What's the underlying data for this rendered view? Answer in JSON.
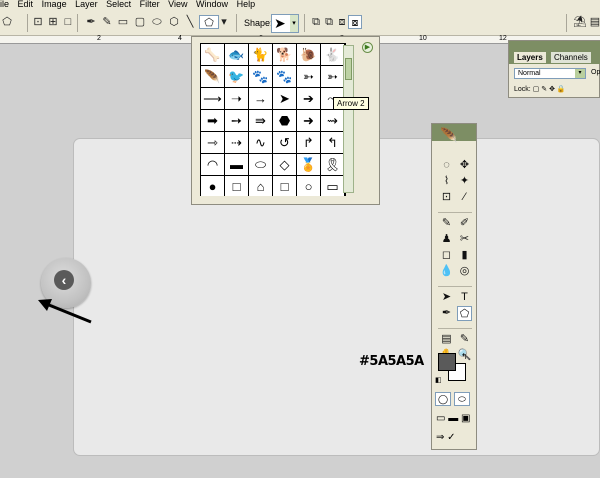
{
  "menu": [
    "ile",
    "Edit",
    "Image",
    "Layer",
    "Select",
    "Filter",
    "View",
    "Window",
    "Help"
  ],
  "options_bar": {
    "shape_label": "Shape:",
    "shape_value": "➤"
  },
  "ruler": {
    "marks": [
      "2",
      "4",
      "6",
      "8",
      "10",
      "12"
    ]
  },
  "shape_picker": {
    "tooltip": "Arrow 2",
    "items": [
      "🦴",
      "🐟",
      "🐈",
      "🐕",
      "🐌",
      "🐇",
      "🪶",
      "🐦",
      "🐾",
      "🐾",
      "➳",
      "➳",
      "⟶",
      "➝",
      "→",
      "➤",
      "➔",
      "⤳",
      "➡",
      "➙",
      "⇛",
      "⬣",
      "➜",
      "⇝",
      "⇾",
      "⇢",
      "∿",
      "↺",
      "↱",
      "↰",
      "◠",
      "▬",
      "⬭",
      "◇",
      "🏅",
      "🎗",
      "●",
      "□",
      "⌂",
      "□",
      "○",
      "▭"
    ],
    "menu_icon": "▶"
  },
  "layers_panel": {
    "tabs": [
      "Layers",
      "Channels"
    ],
    "blend_mode": "Normal",
    "opacity_label": "Op",
    "lock_label": "Lock:"
  },
  "toolbox": {
    "rows": [
      [
        "◌",
        "✥"
      ],
      [
        "⌇",
        "✦"
      ],
      [
        "⊡",
        "⁄"
      ],
      [
        "✎",
        "✐"
      ],
      [
        "♟",
        "✂"
      ],
      [
        "◻",
        "▮"
      ],
      [
        "💧",
        "◎"
      ],
      [
        "➤",
        "T"
      ],
      [
        "✒",
        "⬠"
      ],
      [
        "▤",
        "✎"
      ],
      [
        "✋",
        "🔍"
      ]
    ],
    "fg_color": "#5a5a5a",
    "bg_color": "#ffffff",
    "quickmask": [
      "◯",
      "⬭"
    ],
    "screen": [
      "▭",
      "▬",
      "▣"
    ],
    "jump": [
      "⇒",
      "✓"
    ]
  },
  "annotation": {
    "hex_label": "#5A5A5A"
  },
  "canvas": {
    "back_button_glyph": "‹"
  }
}
